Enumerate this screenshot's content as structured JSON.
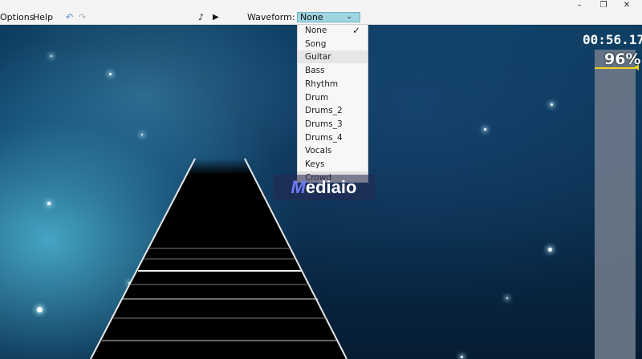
{
  "window": {
    "controls": [
      {
        "name": "minimize-icon",
        "glyph": "–"
      },
      {
        "name": "maximize-icon",
        "glyph": "❐"
      },
      {
        "name": "close-icon",
        "glyph": "✕"
      }
    ]
  },
  "menu": {
    "items": [
      "Options",
      "Help"
    ],
    "undo_glyph": "↶",
    "redo_glyph": "↷",
    "note_glyph": "♪",
    "play_glyph": "▶"
  },
  "waveform": {
    "label": "Waveform:",
    "selected": "None",
    "options": [
      "None",
      "Song",
      "Guitar",
      "Bass",
      "Rhythm",
      "Drum",
      "Drums_2",
      "Drums_3",
      "Drums_4",
      "Vocals",
      "Keys",
      "Crowd"
    ],
    "checked_index": 0,
    "hover_index": 2,
    "check_glyph": "✓",
    "chevron_glyph": "⌄"
  },
  "status": {
    "time": "00:56.17",
    "percent": "96%",
    "percent_value": 96
  },
  "watermark": {
    "first": "M",
    "rest": "ediaio"
  },
  "colors": {
    "select_bg": "#9fd4e0",
    "meter_line": "#f2d21a"
  }
}
